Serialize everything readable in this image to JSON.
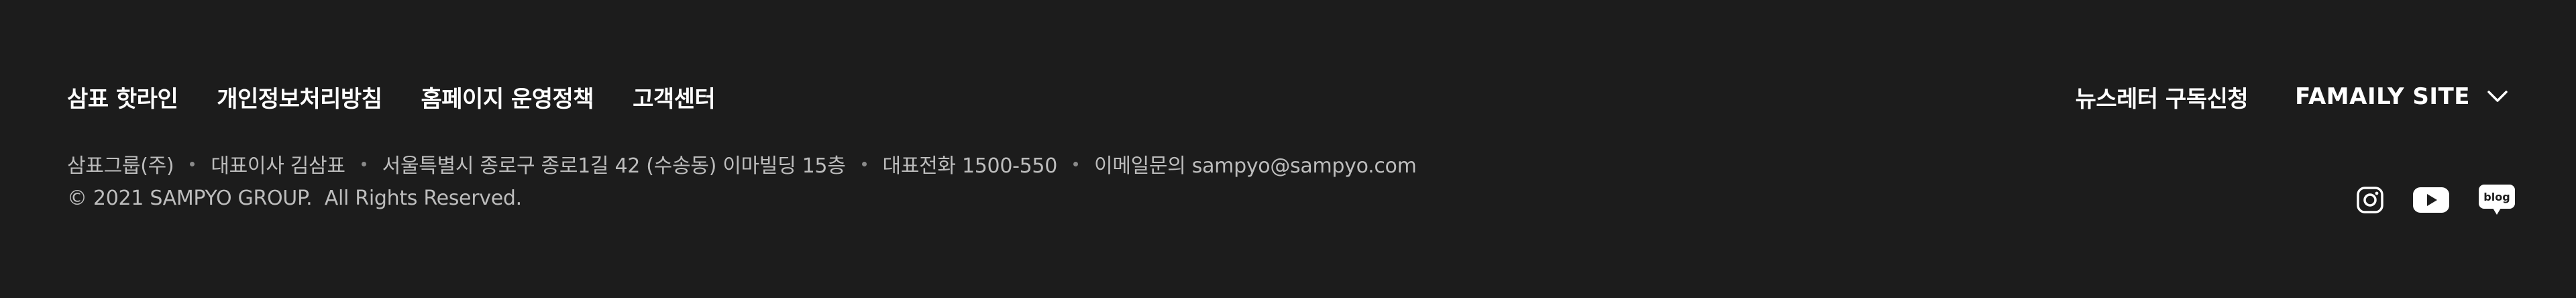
{
  "footer": {
    "links": [
      {
        "label": "삼표 핫라인"
      },
      {
        "label": "개인정보처리방침"
      },
      {
        "label": "홈페이지 운영정책"
      },
      {
        "label": "고객센터"
      }
    ],
    "newsletter_label": "뉴스레터 구독신청",
    "family_site_label": "FAMAILY SITE",
    "info": {
      "company": "삼표그룹(주)",
      "ceo": "대표이사 김삼표",
      "address": "서울특별시 종로구 종로1길 42 (수송동) 이마빌딩 15층",
      "phone": "대표전화 1500-550",
      "email": "이메일문의 sampyo@sampyo.com"
    },
    "copyright": "© 2021 SAMPYO GROUP.  All Rights Reserved.",
    "social": [
      {
        "icon": "instagram-icon"
      },
      {
        "icon": "youtube-icon"
      },
      {
        "icon": "blog-icon",
        "label": "blog"
      }
    ],
    "colors": {
      "background": "#1c1c1c",
      "text_primary": "#ffffff",
      "text_secondary": "#bdbdbd"
    }
  }
}
